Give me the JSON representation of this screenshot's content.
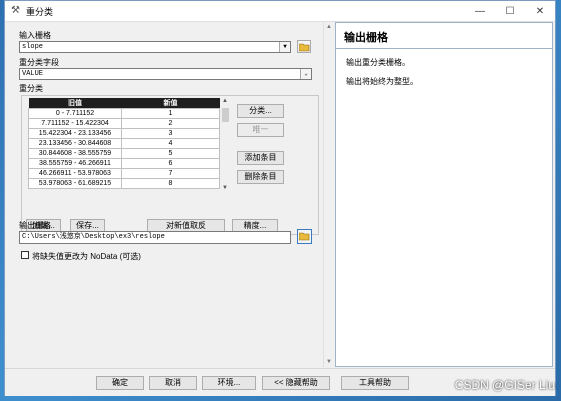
{
  "window": {
    "title": "重分类",
    "minimize": "—",
    "maximize": "☐",
    "close": "✕"
  },
  "form": {
    "input_raster_label": "输入栅格",
    "input_raster_value": "slope",
    "field_label": "重分类字段",
    "field_value": "VALUE",
    "reclass_label": "重分类",
    "table": {
      "headers": [
        "旧值",
        "新值"
      ],
      "rows": [
        [
          "0 - 7.711152",
          "1"
        ],
        [
          "7.711152 - 15.422304",
          "2"
        ],
        [
          "15.422304 - 23.133456",
          "3"
        ],
        [
          "23.133456 - 30.844608",
          "4"
        ],
        [
          "30.844608 - 38.555759",
          "5"
        ],
        [
          "38.555759 - 46.266911",
          "6"
        ],
        [
          "46.266911 - 53.978063",
          "7"
        ],
        [
          "53.978063 - 61.689215",
          "8"
        ]
      ]
    },
    "side_buttons": {
      "classify": "分类...",
      "unique": "唯一",
      "add": "添加条目",
      "delete": "删除条目"
    },
    "bottom_buttons": {
      "load": "加载...",
      "save": "保存...",
      "reverse": "对新值取反",
      "precision": "精度..."
    },
    "output_raster_label": "输出栅格",
    "output_raster_value": "C:\\Users\\浅悠京\\Desktop\\ex3\\reslope",
    "nodata_label": "将缺失值更改为 NoData (可选)"
  },
  "help": {
    "title": "输出栅格",
    "line1": "输出重分类栅格。",
    "line2": "输出将始终为整型。"
  },
  "footer": {
    "ok": "确定",
    "cancel": "取消",
    "env": "环境...",
    "hide_help": "<< 隐藏帮助",
    "tool_help": "工具帮助"
  },
  "watermark": "CSDN @GISer Liu"
}
